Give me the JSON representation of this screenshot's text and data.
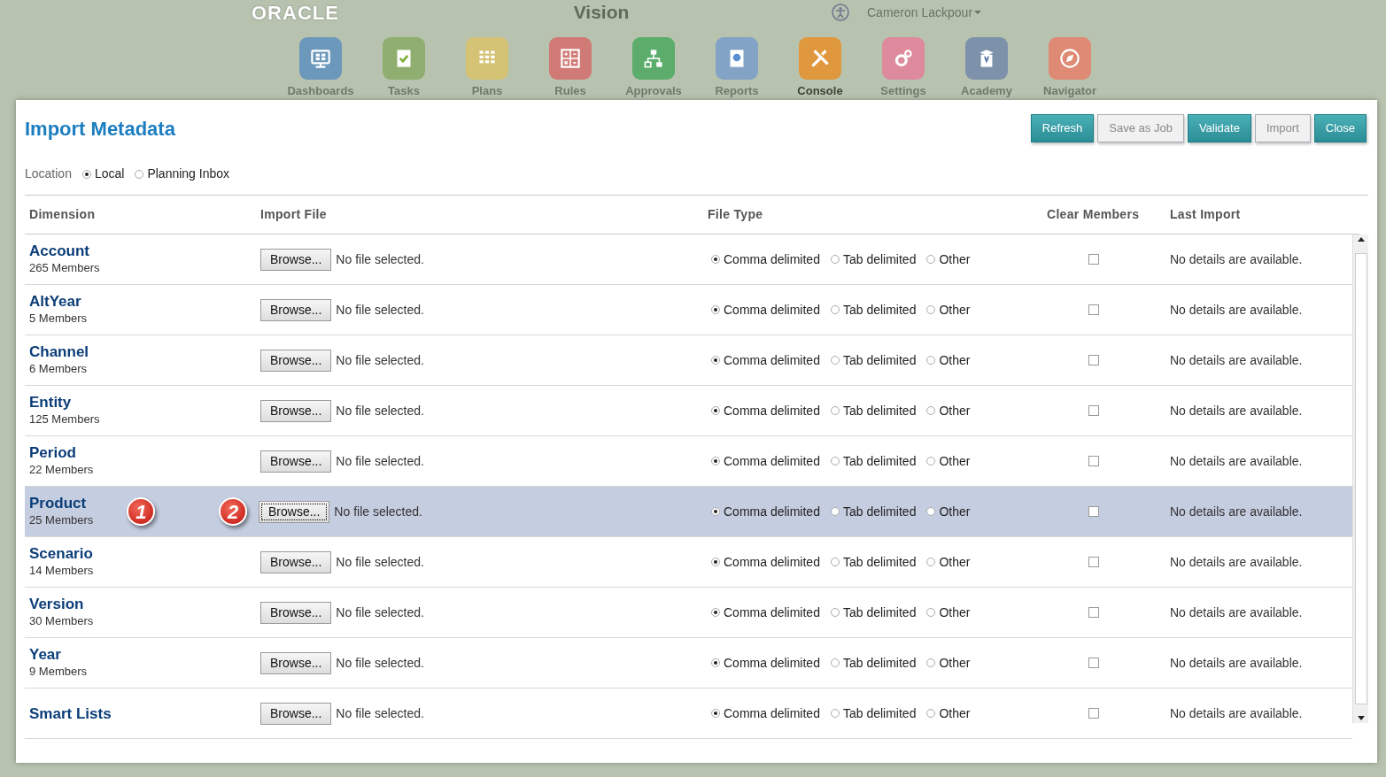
{
  "app_header": {
    "logo": "ORACLE",
    "title": "Vision",
    "user": "Cameron Lackpour",
    "nav": [
      {
        "label": "Dashboards",
        "kind": "dashboards",
        "color": "#6c98bc",
        "selected": false
      },
      {
        "label": "Tasks",
        "kind": "tasks",
        "color": "#8fae70",
        "selected": false
      },
      {
        "label": "Plans",
        "kind": "plans",
        "color": "#d4c275",
        "selected": false
      },
      {
        "label": "Rules",
        "kind": "rules",
        "color": "#d07a76",
        "selected": false
      },
      {
        "label": "Approvals",
        "kind": "approvals",
        "color": "#5cac6c",
        "selected": false
      },
      {
        "label": "Reports",
        "kind": "reports",
        "color": "#82a2c6",
        "selected": false
      },
      {
        "label": "Console",
        "kind": "console",
        "color": "#e0983e",
        "selected": true
      },
      {
        "label": "Settings",
        "kind": "settings",
        "color": "#dc8a9c",
        "selected": false
      },
      {
        "label": "Academy",
        "kind": "academy",
        "color": "#7e91aa",
        "selected": false
      },
      {
        "label": "Navigator",
        "kind": "navigator",
        "color": "#de8a74",
        "selected": false
      }
    ]
  },
  "dialog": {
    "title": "Import Metadata",
    "buttons": [
      {
        "label": "Refresh",
        "disabled": false
      },
      {
        "label": "Save as Job",
        "disabled": true
      },
      {
        "label": "Validate",
        "disabled": false
      },
      {
        "label": "Import",
        "disabled": true
      },
      {
        "label": "Close",
        "disabled": false
      }
    ],
    "location": {
      "label": "Location",
      "options": [
        {
          "label": "Local",
          "selected": true
        },
        {
          "label": "Planning Inbox",
          "selected": false
        }
      ]
    },
    "columns": [
      "Dimension",
      "Import File",
      "File Type",
      "Clear Members",
      "Last Import"
    ],
    "rows": [
      {
        "dimension": "Account",
        "members": "265 Members",
        "browse": "Browse...",
        "file_status": "No file selected.",
        "file_types": [
          {
            "label": "Comma delimited",
            "selected": true
          },
          {
            "label": "Tab delimited",
            "selected": false
          },
          {
            "label": "Other",
            "selected": false
          }
        ],
        "clear_members": false,
        "last_import": "No details are available.",
        "highlighted": false
      },
      {
        "dimension": "AltYear",
        "members": "5 Members",
        "browse": "Browse...",
        "file_status": "No file selected.",
        "file_types": [
          {
            "label": "Comma delimited",
            "selected": true
          },
          {
            "label": "Tab delimited",
            "selected": false
          },
          {
            "label": "Other",
            "selected": false
          }
        ],
        "clear_members": false,
        "last_import": "No details are available.",
        "highlighted": false
      },
      {
        "dimension": "Channel",
        "members": "6 Members",
        "browse": "Browse...",
        "file_status": "No file selected.",
        "file_types": [
          {
            "label": "Comma delimited",
            "selected": true
          },
          {
            "label": "Tab delimited",
            "selected": false
          },
          {
            "label": "Other",
            "selected": false
          }
        ],
        "clear_members": false,
        "last_import": "No details are available.",
        "highlighted": false
      },
      {
        "dimension": "Entity",
        "members": "125 Members",
        "browse": "Browse...",
        "file_status": "No file selected.",
        "file_types": [
          {
            "label": "Comma delimited",
            "selected": true
          },
          {
            "label": "Tab delimited",
            "selected": false
          },
          {
            "label": "Other",
            "selected": false
          }
        ],
        "clear_members": false,
        "last_import": "No details are available.",
        "highlighted": false
      },
      {
        "dimension": "Period",
        "members": "22 Members",
        "browse": "Browse...",
        "file_status": "No file selected.",
        "file_types": [
          {
            "label": "Comma delimited",
            "selected": true
          },
          {
            "label": "Tab delimited",
            "selected": false
          },
          {
            "label": "Other",
            "selected": false
          }
        ],
        "clear_members": false,
        "last_import": "No details are available.",
        "highlighted": false
      },
      {
        "dimension": "Product",
        "members": "25 Members",
        "browse": "Browse...",
        "file_status": "No file selected.",
        "file_types": [
          {
            "label": "Comma delimited",
            "selected": true
          },
          {
            "label": "Tab delimited",
            "selected": false
          },
          {
            "label": "Other",
            "selected": false
          }
        ],
        "clear_members": false,
        "last_import": "No details are available.",
        "highlighted": true,
        "callouts": [
          "1",
          "2"
        ]
      },
      {
        "dimension": "Scenario",
        "members": "14 Members",
        "browse": "Browse...",
        "file_status": "No file selected.",
        "file_types": [
          {
            "label": "Comma delimited",
            "selected": true
          },
          {
            "label": "Tab delimited",
            "selected": false
          },
          {
            "label": "Other",
            "selected": false
          }
        ],
        "clear_members": false,
        "last_import": "No details are available.",
        "highlighted": false
      },
      {
        "dimension": "Version",
        "members": "30 Members",
        "browse": "Browse...",
        "file_status": "No file selected.",
        "file_types": [
          {
            "label": "Comma delimited",
            "selected": true
          },
          {
            "label": "Tab delimited",
            "selected": false
          },
          {
            "label": "Other",
            "selected": false
          }
        ],
        "clear_members": false,
        "last_import": "No details are available.",
        "highlighted": false
      },
      {
        "dimension": "Year",
        "members": "9 Members",
        "browse": "Browse...",
        "file_status": "No file selected.",
        "file_types": [
          {
            "label": "Comma delimited",
            "selected": true
          },
          {
            "label": "Tab delimited",
            "selected": false
          },
          {
            "label": "Other",
            "selected": false
          }
        ],
        "clear_members": false,
        "last_import": "No details are available.",
        "highlighted": false
      },
      {
        "dimension": "Smart Lists",
        "browse": "Browse...",
        "file_status": "No file selected.",
        "file_types": [
          {
            "label": "Comma delimited",
            "selected": true
          },
          {
            "label": "Tab delimited",
            "selected": false
          },
          {
            "label": "Other",
            "selected": false
          }
        ],
        "clear_members": false,
        "last_import": "No details are available.",
        "highlighted": false
      }
    ]
  }
}
